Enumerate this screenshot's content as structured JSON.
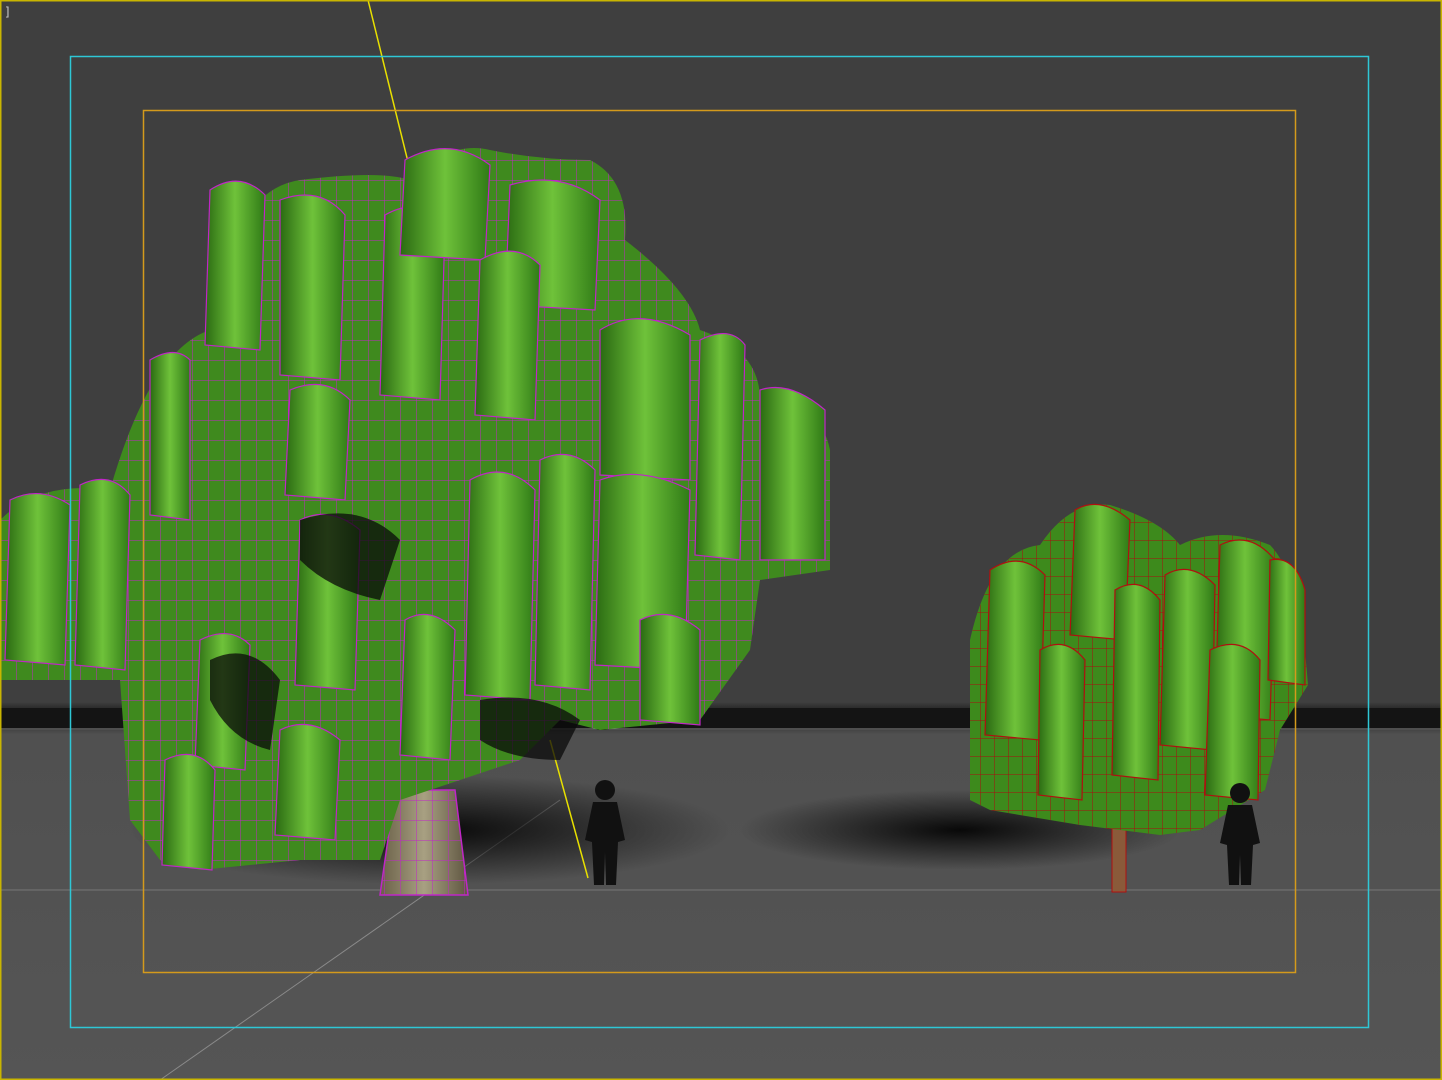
{
  "viewport": {
    "label": "]",
    "active_border_color": "#c9b500",
    "safe_frame_outer_color": "#2ec7d6",
    "safe_frame_inner_color": "#d49a1c",
    "background_color": "#3f3f3f",
    "ground_color": "#545454"
  },
  "scene": {
    "objects": [
      {
        "name": "weeping-willow-large",
        "wireframe_color": "#c026c7",
        "selected": true
      },
      {
        "name": "weeping-willow-small",
        "wireframe_color": "#b01010",
        "selected": false
      },
      {
        "name": "human-silhouette-1"
      },
      {
        "name": "human-silhouette-2"
      }
    ],
    "light_line_color": "#e8e000"
  }
}
